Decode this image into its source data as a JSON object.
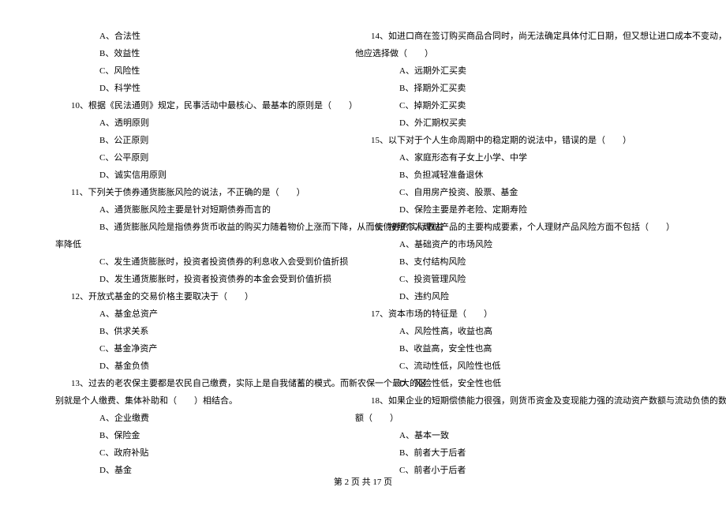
{
  "left_column": {
    "q9_opts": {
      "a": "A、合法性",
      "b": "B、效益性",
      "c": "C、风险性",
      "d": "D、科学性"
    },
    "q10": {
      "stem": "10、根据《民法通则》规定，民事活动中最核心、最基本的原则是（　　）",
      "a": "A、透明原则",
      "b": "B、公正原则",
      "c": "C、公平原则",
      "d": "D、诚实信用原则"
    },
    "q11": {
      "stem": "11、下列关于债券通货膨胀风险的说法，不正确的是（　　）",
      "a": "A、通货膨胀风险主要是针对短期债券而言的",
      "b1": "B、通货膨胀风险是指债券货币收益的购买力随着物价上涨而下降，从而使债券的实际收益",
      "b2": "率降低",
      "c": "C、发生通货膨胀时，投资者投资债券的利息收入会受到价值折损",
      "d": "D、发生通货膨胀时，投资者投资债券的本金会受到价值折损"
    },
    "q12": {
      "stem": "12、开放式基金的交易价格主要取决于（　　）",
      "a": "A、基金总资产",
      "b": "B、供求关系",
      "c": "C、基金净资产",
      "d": "D、基金负债"
    },
    "q13": {
      "stem1": "13、过去的老农保主要都是农民自己缴费，实际上是自我储蓄的模式。而新农保一个最大的区",
      "stem2": "别就是个人缴费、集体补助和（　　）相结合。",
      "a": "A、企业缴费",
      "b": "B、保险金",
      "c": "C、政府补贴",
      "d": "D、基金"
    }
  },
  "right_column": {
    "q14": {
      "stem1": "14、如进口商在签订购买商品合同时，尚无法确定具体付汇日期，但又想让进口成本不变动，",
      "stem2": "他应选择做（　　）",
      "a": "A、远期外汇买卖",
      "b": "B、择期外汇买卖",
      "c": "C、掉期外汇买卖",
      "d": "D、外汇期权买卖"
    },
    "q15": {
      "stem": "15、以下对于个人生命周期中的稳定期的说法中，错误的是（　　）",
      "a": "A、家庭形态有子女上小学、中学",
      "b": "B、负担减轻准备退休",
      "c": "C、自用房产投资、股票、基金",
      "d": "D、保险主要是养老险、定期寿险"
    },
    "q16": {
      "stem": "16、按照个人理财产品的主要构成要素，个人理财产品风险方面不包括（　　）",
      "a": "A、基础资产的市场风险",
      "b": "B、支付结构风险",
      "c": "C、投资管理风险",
      "d": "D、违约风险"
    },
    "q17": {
      "stem": "17、资本市场的特征是（　　）",
      "a": "A、风险性高，收益也高",
      "b": "B、收益高，安全性也高",
      "c": "C、流动性低，风险性也低",
      "d": "D、风险性低，安全性也低"
    },
    "q18": {
      "stem1": "18、如果企业的短期偿债能力很强，则货币资金及变现能力强的流动资产数额与流动负债的数",
      "stem2": "额（　　）",
      "a": "A、基本一致",
      "b": "B、前者大于后者",
      "c": "C、前者小于后者"
    }
  },
  "footer": "第 2 页 共 17 页"
}
